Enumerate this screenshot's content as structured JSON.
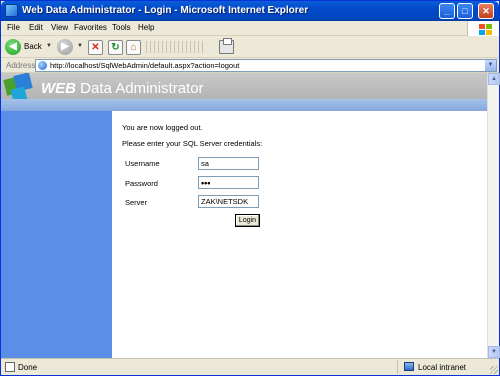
{
  "window": {
    "title": "Web Data Administrator - Login - Microsoft Internet Explorer",
    "controls": {
      "minimize": "_",
      "maximize": "□",
      "close": "✕"
    }
  },
  "menu": [
    "File",
    "Edit",
    "View",
    "Favorites",
    "Tools",
    "Help"
  ],
  "toolbar": {
    "back_label": "Back",
    "icons": [
      "back-arrow-icon",
      "forward-arrow-icon",
      "stop-icon",
      "refresh-icon",
      "home-icon",
      "print-icon"
    ]
  },
  "address": {
    "label": "Address",
    "url": "http://localhost/SqlWebAdmin/default.aspx?action=logout"
  },
  "banner": {
    "title_bold": "WEB",
    "title_rest": " Data Administrator"
  },
  "page": {
    "logged_out": "You are now logged out.",
    "instructions": "Please enter your SQL Server credentials:",
    "fields": {
      "username": {
        "label": "Username",
        "value": "sa"
      },
      "password": {
        "label": "Password",
        "value": "•••"
      },
      "server": {
        "label": "Server",
        "value": "ZAK\\NETSDK"
      }
    },
    "login_button": "Login"
  },
  "status": {
    "text": "Done",
    "zone": "Local intranet"
  },
  "colors": {
    "titlebar": "#0149c9",
    "left_panel": "#5b8ee6",
    "banner_strip": "#a5c2ea"
  }
}
